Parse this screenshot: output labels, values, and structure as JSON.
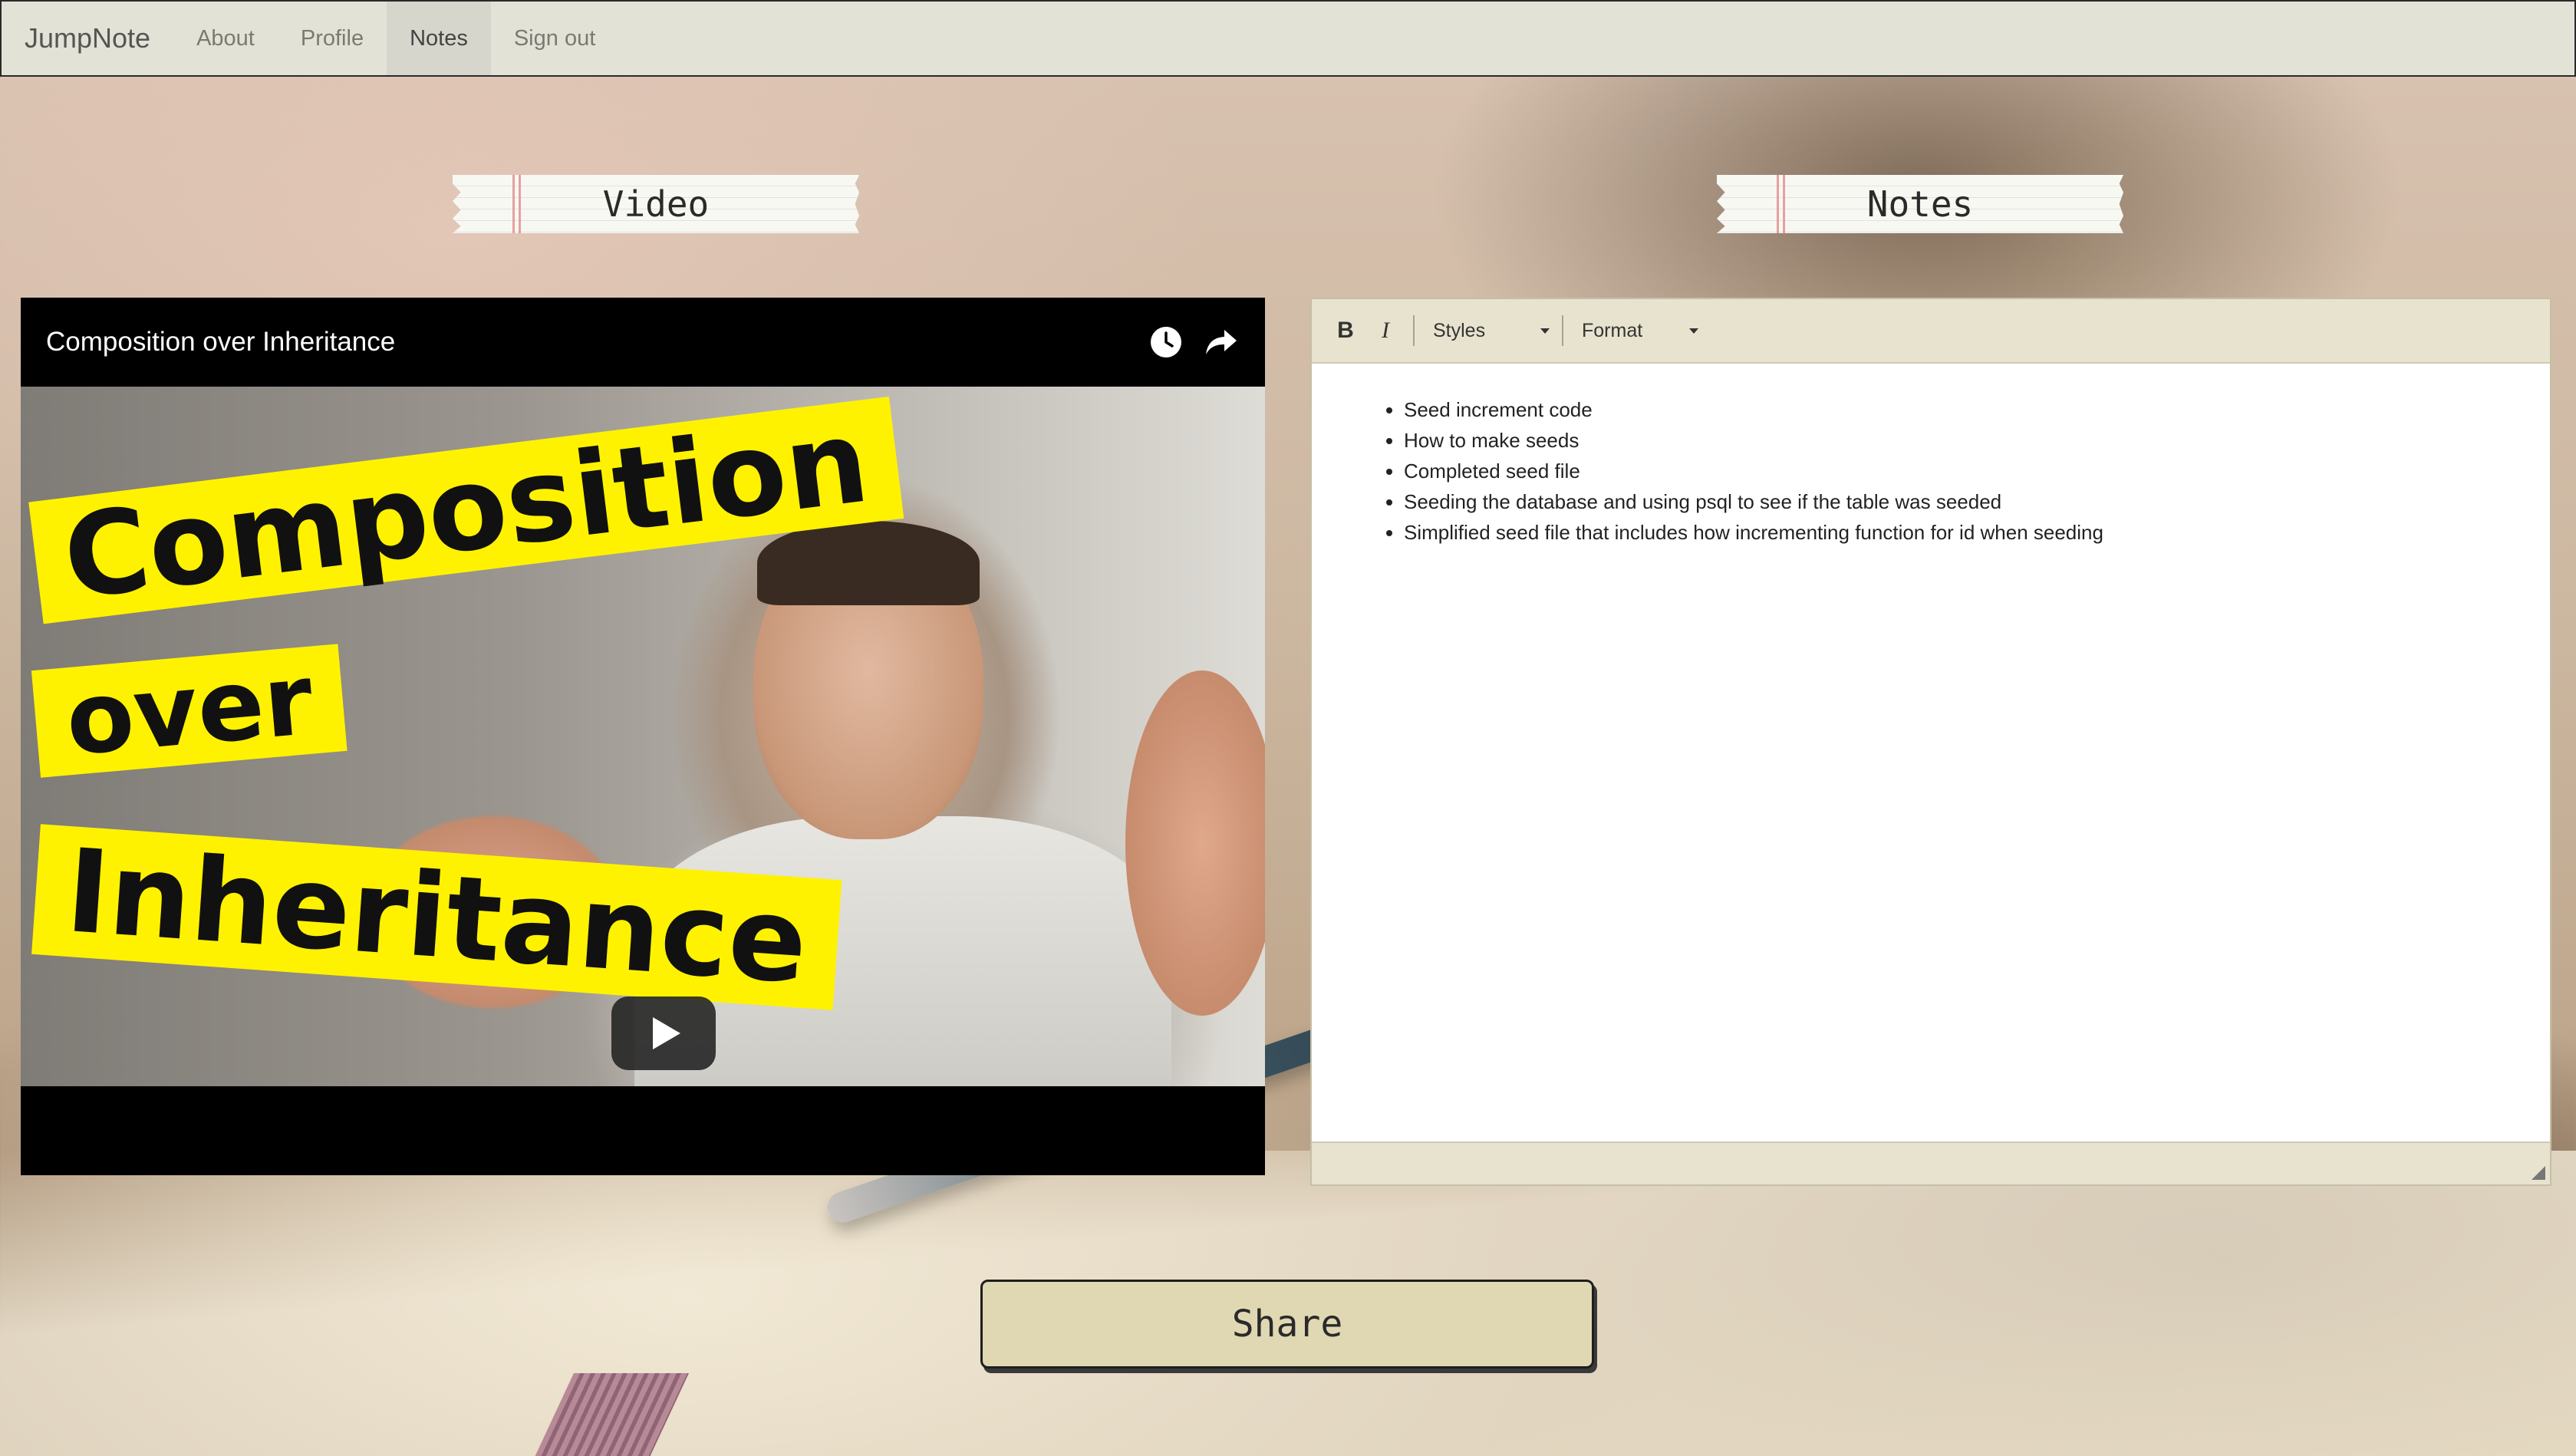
{
  "navbar": {
    "brand": "JumpNote",
    "items": [
      {
        "label": "About",
        "active": false
      },
      {
        "label": "Profile",
        "active": false
      },
      {
        "label": "Notes",
        "active": true
      },
      {
        "label": "Sign out",
        "active": false
      }
    ]
  },
  "sections": {
    "video_label": "Video",
    "notes_label": "Notes"
  },
  "video": {
    "title": "Composition over Inheritance",
    "thumbnail_text": [
      "Composition",
      "over",
      "Inheritance"
    ],
    "actions": [
      "watch-later-icon",
      "share-arrow-icon"
    ]
  },
  "editor": {
    "toolbar": {
      "bold_label": "B",
      "italic_label": "I",
      "styles_label": "Styles",
      "format_label": "Format"
    },
    "notes": [
      "Seed increment code",
      "How to make seeds",
      "Completed seed file",
      "Seeding the database and using psql to see if the table was seeded",
      "Simplified seed file that includes how incrementing function for id when seeding"
    ]
  },
  "share": {
    "label": "Share"
  },
  "colors": {
    "navbar_bg": "#e2e2d6",
    "toolbar_bg": "#e8e3cf",
    "share_bg": "#e0d8b2",
    "banner_yellow": "#fff200"
  }
}
